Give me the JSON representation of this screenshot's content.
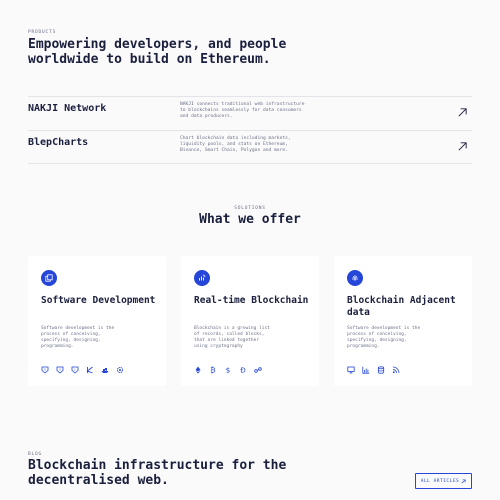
{
  "products": {
    "eyebrow": "PRODUCTS",
    "title": "Empowering developers, and people worldwide to build on Ethereum.",
    "items": [
      {
        "name": "NAKJI Network",
        "description": "NAKJI connects traditional web infrastructure to blockchains seamlessly for data consumers and data producers."
      },
      {
        "name": "BlepCharts",
        "description": "Chart blockchain data including markets, liquidity pools, and stats on Ethereum, Binance, Smart Chain, Polygon and more."
      }
    ]
  },
  "solutions": {
    "eyebrow": "SOLUTIONS",
    "title": "What we offer",
    "cards": [
      {
        "title": "Software Development",
        "description": "Software development is the process of conceiving, specifying, designing, programming.",
        "badge_icon": "copy-icon",
        "icons": [
          "shield-icon",
          "shield-icon",
          "shield-icon",
          "k-logo-icon",
          "boat-icon",
          "cog-icon"
        ]
      },
      {
        "title": "Real-time Blockchain",
        "description": "Blockchain is a growing list of records, called blocks, that are linked together using cryptography",
        "badge_icon": "refresh-chart-icon",
        "icons": [
          "ethereum-icon",
          "bitcoin-icon",
          "dollar-icon",
          "dash-icon",
          "link-icon"
        ]
      },
      {
        "title": "Blockchain Adjacent data",
        "description": "Software development is the process of conceiving, specifying, designing, programming.",
        "badge_icon": "fingerprint-icon",
        "icons": [
          "monitor-icon",
          "bar-chart-icon",
          "database-icon",
          "signal-icon"
        ]
      }
    ]
  },
  "blog": {
    "eyebrow": "BLOG",
    "title": "Blockchain infrastructure for the decentralised web.",
    "button_label": "ALL ARTICLES",
    "button_icon": "arrow-up-right-icon"
  },
  "colors": {
    "accent": "#2546d8",
    "text": "#1a1f3d",
    "muted": "#6b7088",
    "background": "#fafafa"
  }
}
